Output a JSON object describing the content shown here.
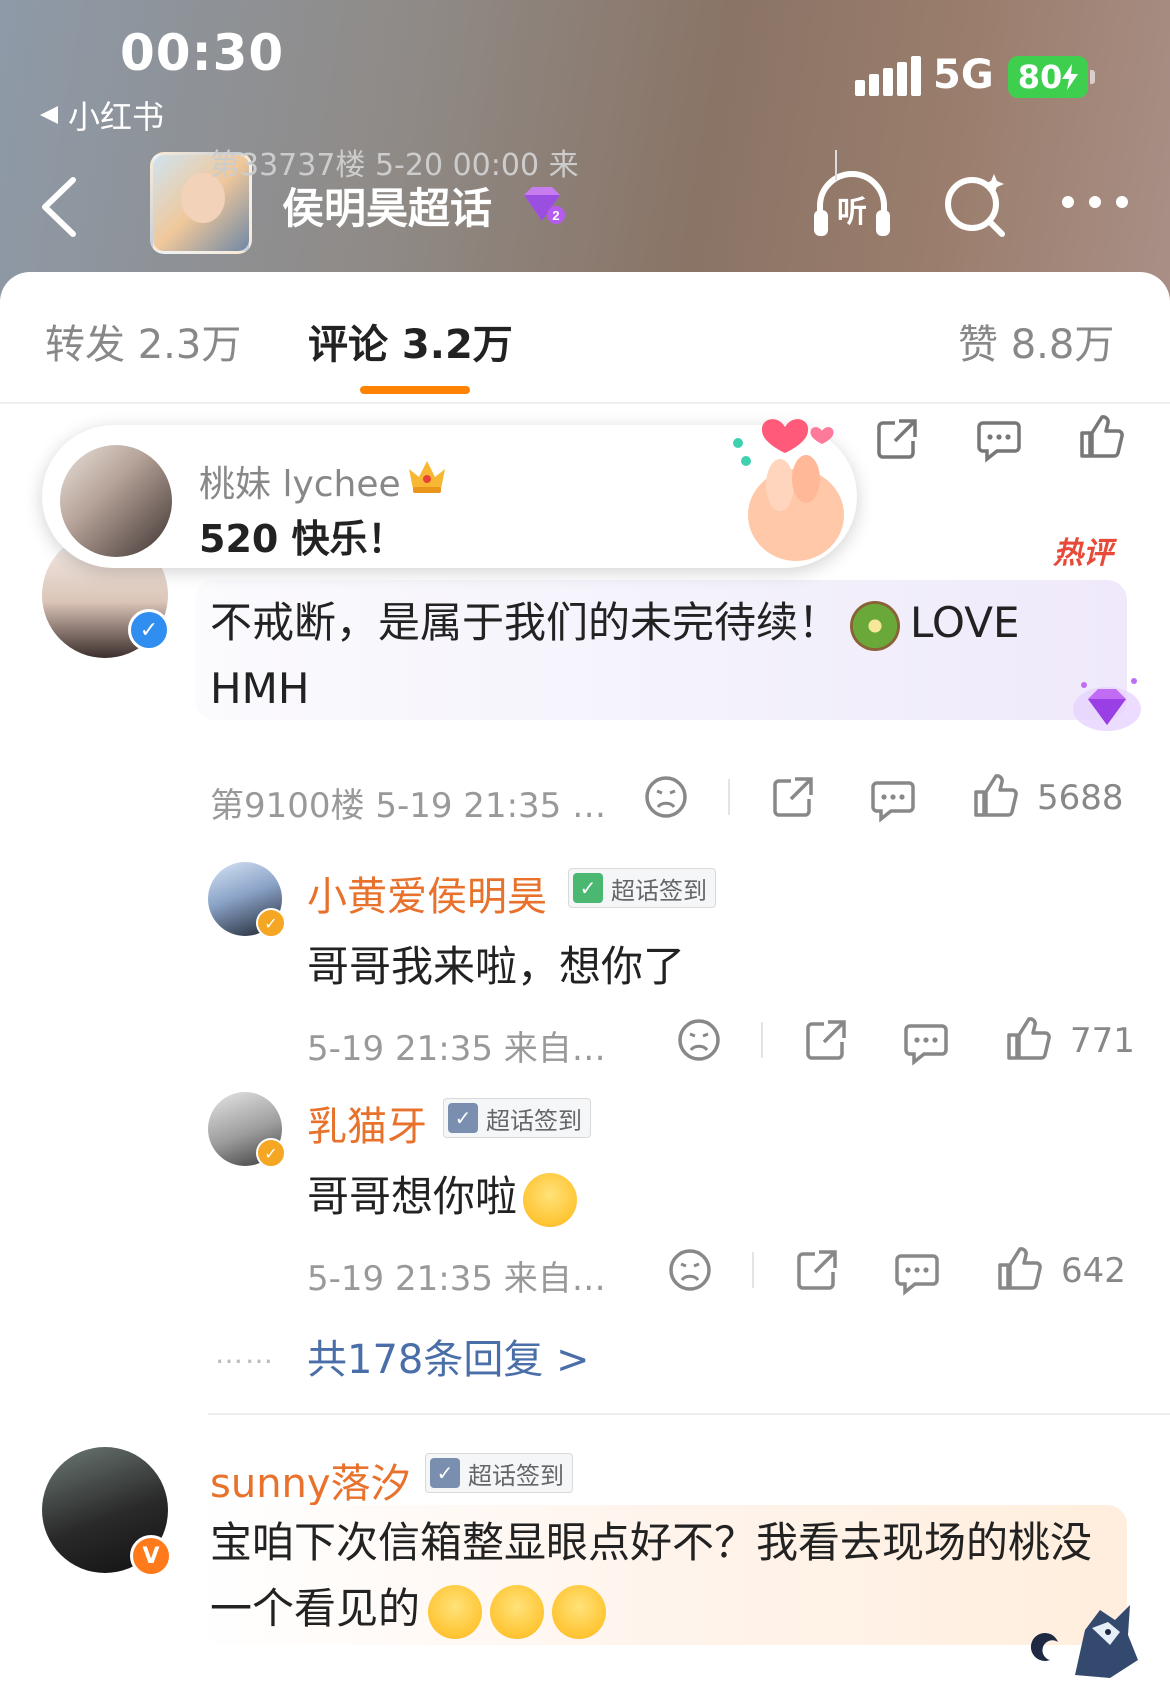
{
  "status_bar": {
    "time": "00:30",
    "back_app_label": "小红书",
    "network": "5G",
    "battery": "80"
  },
  "nav": {
    "topic_title": "侯明昊超话",
    "listen_label": "听",
    "icons": [
      "back-icon",
      "listen-icon",
      "search-icon",
      "more-icon"
    ]
  },
  "tabs": [
    {
      "label": "转发 2.3万"
    },
    {
      "label": "评论 3.2万",
      "active": true
    },
    {
      "label": "赞 8.8万"
    }
  ],
  "ghost_row": {
    "text": "第33737楼 5-20 00:00 来"
  },
  "toast": {
    "name": "桃妹 lychee",
    "message": "520 快乐！"
  },
  "hot_comment": {
    "hot_label": "热评",
    "text_before": "不戒断，是属于我们的未完待续！",
    "text_after": "LOVE HMH",
    "floor_meta": "第9100楼 5-19 21:35 …",
    "likes": "5688"
  },
  "replies": [
    {
      "name": "小黄爱侯明昊",
      "tag": "超话签到",
      "text": "哥哥我来啦，想你了",
      "meta": "5-19 21:35 来自…",
      "likes": "771"
    },
    {
      "name": "乳猫牙",
      "tag": "超话签到",
      "text": "哥哥想你啦",
      "meta": "5-19 21:35 来自…",
      "likes": "642"
    }
  ],
  "more_replies": {
    "dots": "……",
    "link": "共178条回复 >"
  },
  "third_comment": {
    "name": "sunny落汐",
    "tag": "超话签到",
    "text": "宝咱下次信箱整显眼点好不？我看去现场的桃没一个看见的"
  },
  "colors": {
    "accent": "#ff8200",
    "username": "#e8722c",
    "link": "#4a6ea8",
    "hot": "#e84a3a",
    "verified_blue": "#2f8ef0",
    "verified_gold": "#f5a623"
  }
}
